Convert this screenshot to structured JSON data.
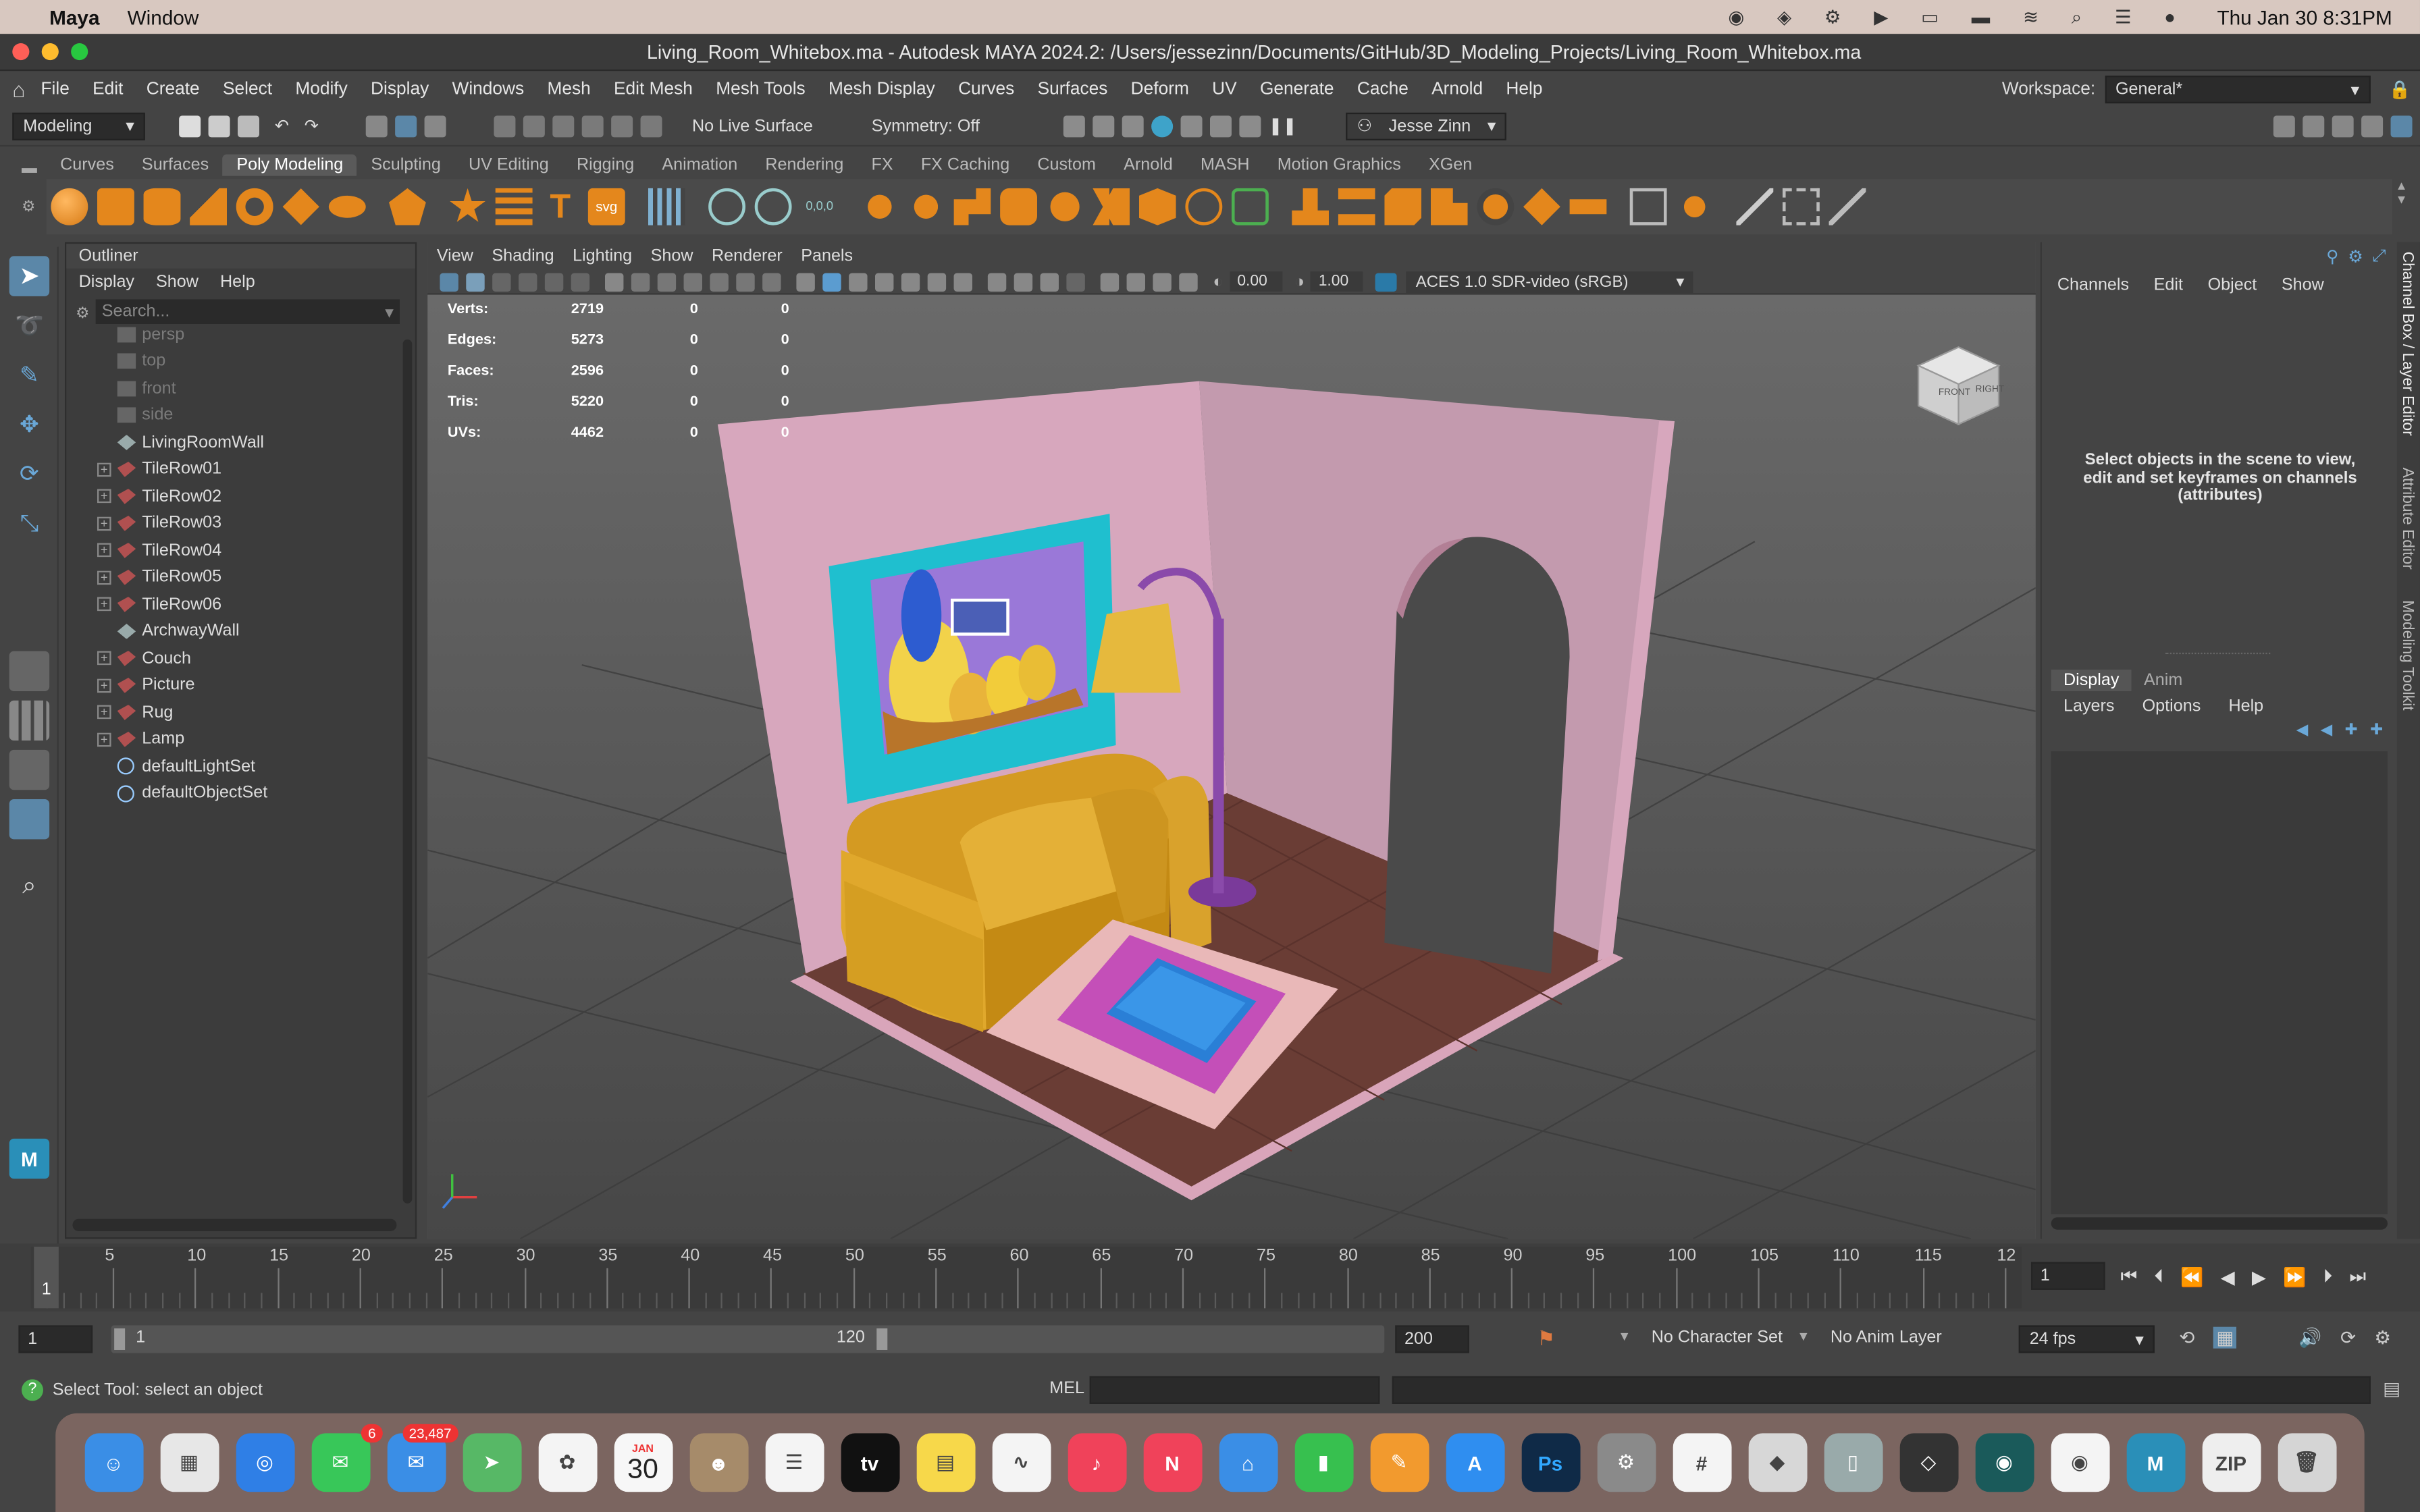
{
  "mac": {
    "app": "Maya",
    "window_menu": "Window",
    "datetime": "Thu Jan 30  8:31PM"
  },
  "title": "Living_Room_Whitebox.ma - Autodesk MAYA 2024.2: /Users/jessezinn/Documents/GitHub/3D_Modeling_Projects/Living_Room_Whitebox.ma",
  "menus": [
    "File",
    "Edit",
    "Create",
    "Select",
    "Modify",
    "Display",
    "Windows",
    "Mesh",
    "Edit Mesh",
    "Mesh Tools",
    "Mesh Display",
    "Curves",
    "Surfaces",
    "Deform",
    "UV",
    "Generate",
    "Cache",
    "Arnold",
    "Help"
  ],
  "workspace": {
    "label": "Workspace:",
    "value": "General*"
  },
  "status": {
    "mode": "Modeling",
    "live_surface": "No Live Surface",
    "symmetry": "Symmetry: Off",
    "user": "Jesse Zinn"
  },
  "shelf_tabs": [
    "Curves",
    "Surfaces",
    "Poly Modeling",
    "Sculpting",
    "UV Editing",
    "Rigging",
    "Animation",
    "Rendering",
    "FX",
    "FX Caching",
    "Custom",
    "Arnold",
    "MASH",
    "Motion Graphics",
    "XGen"
  ],
  "shelf_active": "Poly Modeling",
  "outliner": {
    "title": "Outliner",
    "menu": [
      "Display",
      "Show",
      "Help"
    ],
    "search_placeholder": "Search...",
    "items": [
      {
        "label": "persp",
        "dim": true,
        "expand": false
      },
      {
        "label": "top",
        "dim": true,
        "expand": false
      },
      {
        "label": "front",
        "dim": true,
        "expand": false
      },
      {
        "label": "side",
        "dim": true,
        "expand": false
      },
      {
        "label": "LivingRoomWall",
        "dim": false,
        "expand": false
      },
      {
        "label": "TileRow01",
        "dim": false,
        "expand": true
      },
      {
        "label": "TileRow02",
        "dim": false,
        "expand": true
      },
      {
        "label": "TileRow03",
        "dim": false,
        "expand": true
      },
      {
        "label": "TileRow04",
        "dim": false,
        "expand": true
      },
      {
        "label": "TileRow05",
        "dim": false,
        "expand": true
      },
      {
        "label": "TileRow06",
        "dim": false,
        "expand": true
      },
      {
        "label": "ArchwayWall",
        "dim": false,
        "expand": false
      },
      {
        "label": "Couch",
        "dim": false,
        "expand": true
      },
      {
        "label": "Picture",
        "dim": false,
        "expand": true
      },
      {
        "label": "Rug",
        "dim": false,
        "expand": true
      },
      {
        "label": "Lamp",
        "dim": false,
        "expand": true
      },
      {
        "label": "defaultLightSet",
        "dim": false,
        "expand": false
      },
      {
        "label": "defaultObjectSet",
        "dim": false,
        "expand": false
      }
    ]
  },
  "viewport": {
    "menu": [
      "View",
      "Shading",
      "Lighting",
      "Show",
      "Renderer",
      "Panels"
    ],
    "exposure": "0.00",
    "gamma": "1.00",
    "colorspace": "ACES 1.0 SDR-video (sRGB)",
    "hud": [
      [
        "Verts:",
        "2719",
        "0",
        "0"
      ],
      [
        "Edges:",
        "5273",
        "0",
        "0"
      ],
      [
        "Faces:",
        "2596",
        "0",
        "0"
      ],
      [
        "Tris:",
        "5220",
        "0",
        "0"
      ],
      [
        "UVs:",
        "4462",
        "0",
        "0"
      ]
    ],
    "cube_front": "FRONT",
    "cube_right": "RIGHT"
  },
  "channel_box": {
    "menu": [
      "Channels",
      "Edit",
      "Object",
      "Show"
    ],
    "hint": "Select objects in the scene to view, edit and set keyframes on channels (attributes)"
  },
  "layer_editor": {
    "tabs": [
      "Display",
      "Anim"
    ],
    "menu": [
      "Layers",
      "Options",
      "Help"
    ]
  },
  "side_tabs": [
    "Channel Box / Layer Editor",
    "Attribute Editor",
    "Modeling Toolkit"
  ],
  "timeline": {
    "ticks": [
      "5",
      "10",
      "15",
      "20",
      "25",
      "30",
      "35",
      "40",
      "45",
      "50",
      "55",
      "60",
      "65",
      "70",
      "75",
      "80",
      "85",
      "90",
      "95",
      "100",
      "105",
      "110",
      "115",
      "12"
    ],
    "current": "1",
    "frame_field": "1"
  },
  "range": {
    "start": "1",
    "inner_start": "1",
    "inner_end": "120",
    "end": "200",
    "char_set": "No Character Set",
    "anim_layer": "No Anim Layer",
    "fps": "24 fps"
  },
  "cmd": {
    "help": "Select Tool: select an object",
    "mel": "MEL"
  },
  "dock": [
    {
      "name": "Finder",
      "color": "#3a8ee6",
      "glyph": "☺"
    },
    {
      "name": "Launchpad",
      "color": "#e7e7e7",
      "glyph": "▦"
    },
    {
      "name": "Safari",
      "color": "#2f7fe6",
      "glyph": "◎"
    },
    {
      "name": "Messages",
      "color": "#38c759",
      "glyph": "✉",
      "badge": "6"
    },
    {
      "name": "Mail",
      "color": "#3a8ee6",
      "glyph": "✉",
      "badge": "23,487"
    },
    {
      "name": "Maps",
      "color": "#57b866",
      "glyph": "➤"
    },
    {
      "name": "Photos",
      "color": "#f4f4f4",
      "glyph": "✿"
    },
    {
      "name": "Calendar",
      "color": "#f7f7f7",
      "glyph": "30"
    },
    {
      "name": "Contacts",
      "color": "#a68b6a",
      "glyph": "☻"
    },
    {
      "name": "Reminders",
      "color": "#f4f4f4",
      "glyph": "☰"
    },
    {
      "name": "TV",
      "color": "#111",
      "glyph": "tv"
    },
    {
      "name": "Notes",
      "color": "#f7d84a",
      "glyph": "▤"
    },
    {
      "name": "Freeform",
      "color": "#f4f4f4",
      "glyph": "∿"
    },
    {
      "name": "Music",
      "color": "#f0425a",
      "glyph": "♪"
    },
    {
      "name": "News",
      "color": "#f0425a",
      "glyph": "N"
    },
    {
      "name": "Keynote",
      "color": "#3a8ee6",
      "glyph": "⌂"
    },
    {
      "name": "Numbers",
      "color": "#37c04f",
      "glyph": "▮"
    },
    {
      "name": "Pages",
      "color": "#f29a2e",
      "glyph": "✎"
    },
    {
      "name": "App Store",
      "color": "#2f8ef0",
      "glyph": "A"
    },
    {
      "name": "Photoshop",
      "color": "#0f2a47",
      "glyph": "Ps"
    },
    {
      "name": "System Settings",
      "color": "#8a8a8a",
      "glyph": "⚙"
    },
    {
      "name": "Slack",
      "color": "#f4f4f4",
      "glyph": "#"
    },
    {
      "name": "Roblox",
      "color": "#d7d7d7",
      "glyph": "◆"
    },
    {
      "name": "iPhone Mirroring",
      "color": "#9aa",
      "glyph": "▯"
    },
    {
      "name": "Unity",
      "color": "#333",
      "glyph": "◇"
    },
    {
      "name": "GitKraken",
      "color": "#1a5a5a",
      "glyph": "◉"
    },
    {
      "name": "Chrome",
      "color": "#f4f4f4",
      "glyph": "◉"
    },
    {
      "name": "Maya",
      "color": "#2a8fb8",
      "glyph": "M"
    },
    {
      "name": "Archive",
      "color": "#eee",
      "glyph": "ZIP"
    },
    {
      "name": "Trash",
      "color": "#d5d5d5",
      "glyph": "🗑"
    }
  ],
  "calendar": {
    "month": "JAN",
    "day": "30"
  }
}
